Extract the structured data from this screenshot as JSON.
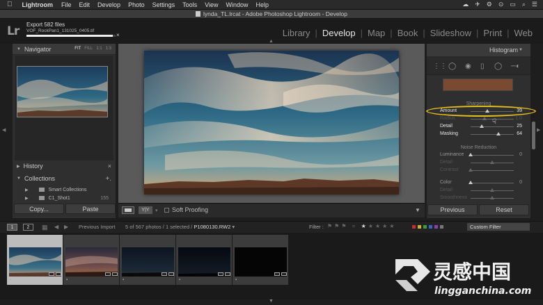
{
  "menubar": {
    "apple": "",
    "app_name": "Lightroom",
    "items": [
      "File",
      "Edit",
      "Develop",
      "Photo",
      "Settings",
      "Tools",
      "View",
      "Window",
      "Help"
    ],
    "right_icons": [
      "☁",
      "✈",
      "⚙",
      "⊙",
      "▭",
      "⌕",
      "☰"
    ]
  },
  "window": {
    "title": "lynda_TL.lrcat - Adobe Photoshop Lightroom - Develop"
  },
  "identity": {
    "logo": "Lr",
    "export_title": "Export 582 files",
    "export_file": "VOF_RockPan1_131025_0405.tif",
    "export_progress": 0.97,
    "export_close": "×"
  },
  "modules": [
    "Library",
    "Develop",
    "Map",
    "Book",
    "Slideshow",
    "Print",
    "Web"
  ],
  "active_module": "Develop",
  "left_panel": {
    "navigator": {
      "title": "Navigator",
      "options": [
        "FIT",
        "FILL",
        "1:1",
        "1:3"
      ]
    },
    "history": {
      "title": "History",
      "close": "×"
    },
    "collections": {
      "title": "Collections",
      "add": "+.",
      "items": [
        {
          "name": "Smart Collections",
          "count": ""
        },
        {
          "name": "C1_Shot1",
          "count": "155"
        }
      ]
    },
    "copy_label": "Copy...",
    "paste_label": "Paste"
  },
  "toolbar": {
    "yy_label": "Y|Y",
    "soft_proofing": "Soft Proofing",
    "menu": "▼"
  },
  "right_panel": {
    "histogram_title": "Histogram",
    "sharpening": {
      "title": "Sharpening",
      "sliders": [
        {
          "label": "Amount",
          "value": "39",
          "pos": 0.39,
          "style": "bright"
        },
        {
          "label": "Radius",
          "value": "1.0",
          "pos": 0.33,
          "style": "dim"
        },
        {
          "label": "Detail",
          "value": "25",
          "pos": 0.25,
          "style": "bright"
        },
        {
          "label": "Masking",
          "value": "64",
          "pos": 0.64,
          "style": "bright"
        }
      ]
    },
    "noise_reduction": {
      "title": "Noise Reduction",
      "sliders": [
        {
          "label": "Luminance",
          "value": "0",
          "pos": 0.0,
          "style": "normal"
        },
        {
          "label": "Detail",
          "value": "",
          "pos": 0.5,
          "style": "dim"
        },
        {
          "label": "Contrast",
          "value": "",
          "pos": 0.0,
          "style": "dim"
        },
        {
          "label": "Color",
          "value": "0",
          "pos": 0.0,
          "style": "normal"
        },
        {
          "label": "Detail",
          "value": "",
          "pos": 0.5,
          "style": "dim"
        },
        {
          "label": "Smoothness",
          "value": "",
          "pos": 0.5,
          "style": "dim"
        }
      ]
    },
    "previous_label": "Previous",
    "reset_label": "Reset"
  },
  "filmstrip_bar": {
    "screen1": "1",
    "screen2": "2",
    "source": "Previous Import",
    "count_text": "5 of 567 photos / 1 selected /",
    "filename": "P1080130.RW2",
    "filename_suffix": " ▾",
    "filter_label": "Filter :",
    "stars_prefix": "=",
    "custom_filter": "Custom Filter"
  },
  "colors": {
    "accent": "#e8c21a",
    "chips": [
      "#c23030",
      "#c9b22d",
      "#3e9c3e",
      "#3a64c4",
      "#8d3fb0",
      "#777777"
    ]
  },
  "watermark": {
    "brand": "灵感中国",
    "url": "lingganchina.com"
  }
}
